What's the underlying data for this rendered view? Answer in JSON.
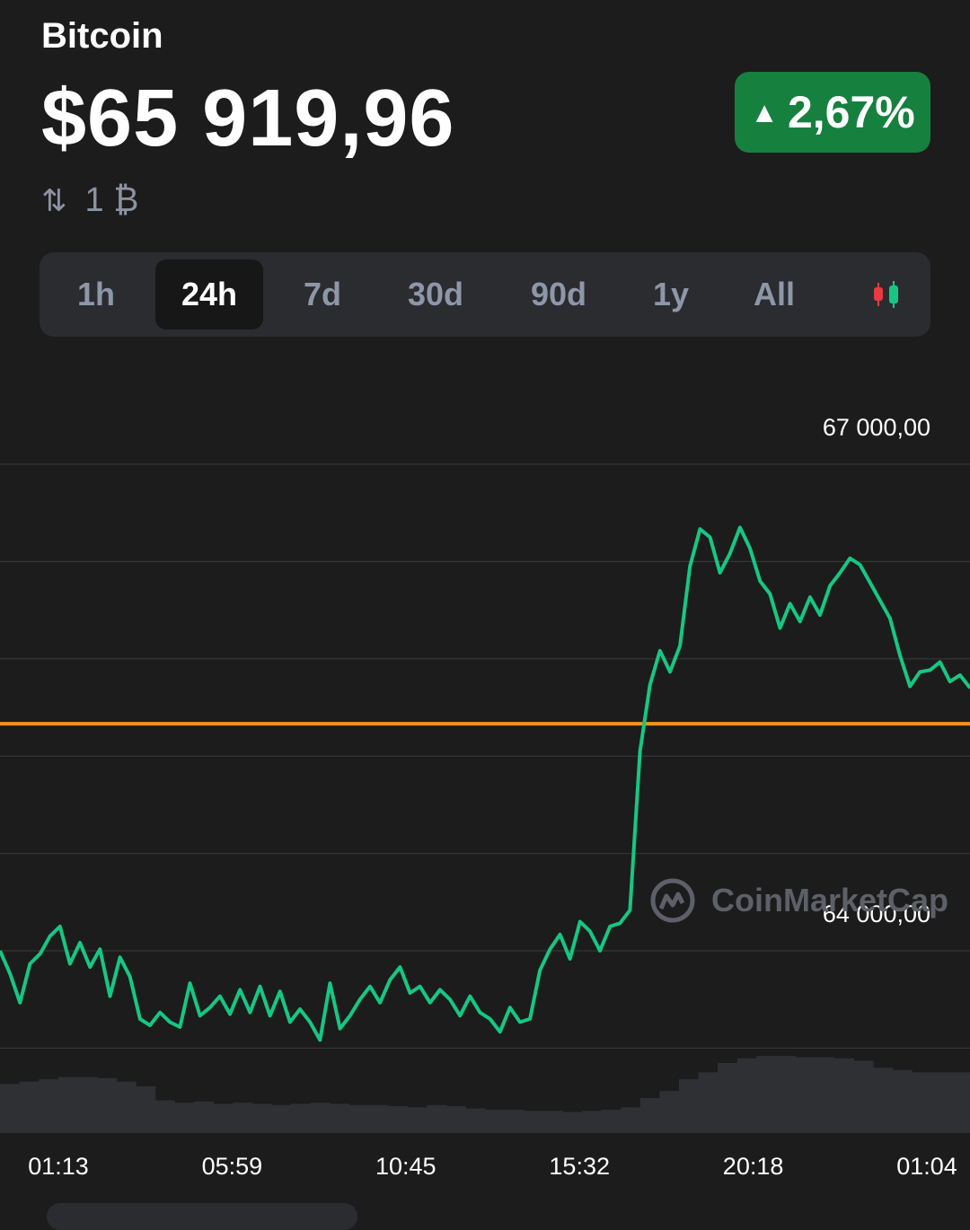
{
  "header": {
    "coin_name": "Bitcoin",
    "price": "$65 919,96",
    "conversion": "1 ₿",
    "swap_icon": "swap-arrows-icon",
    "change": "2,67%",
    "change_direction": "up",
    "change_color": "#16803f"
  },
  "tabs": [
    {
      "label": "1h"
    },
    {
      "label": "24h",
      "active": true
    },
    {
      "label": "7d"
    },
    {
      "label": "30d"
    },
    {
      "label": "90d"
    },
    {
      "label": "1y"
    },
    {
      "label": "All"
    }
  ],
  "candle_toggle_icon": "candlestick-icon",
  "watermark": "CoinMarketCap",
  "chart_data": {
    "type": "line",
    "price_labels": [
      "67 000,00",
      "64 000,00"
    ],
    "y_ticks": [
      64000,
      67000
    ],
    "ylim": [
      63500,
      67500
    ],
    "x_ticks": [
      "01:13",
      "05:59",
      "10:45",
      "15:32",
      "20:18",
      "01:04"
    ],
    "reference_line": {
      "value": 65400,
      "color": "#f7931a"
    },
    "line_color": "#16c784",
    "grid": true,
    "series": [
      {
        "points": [
          [
            0,
            64000
          ],
          [
            1,
            63860
          ],
          [
            2,
            63680
          ],
          [
            3,
            63920
          ],
          [
            4,
            63980
          ],
          [
            5,
            64090
          ],
          [
            6,
            64150
          ],
          [
            7,
            63920
          ],
          [
            8,
            64050
          ],
          [
            9,
            63900
          ],
          [
            10,
            64010
          ],
          [
            11,
            63720
          ],
          [
            12,
            63960
          ],
          [
            13,
            63840
          ],
          [
            14,
            63580
          ],
          [
            15,
            63540
          ],
          [
            16,
            63620
          ],
          [
            17,
            63560
          ],
          [
            18,
            63530
          ],
          [
            19,
            63800
          ],
          [
            20,
            63600
          ],
          [
            21,
            63650
          ],
          [
            22,
            63720
          ],
          [
            23,
            63610
          ],
          [
            24,
            63760
          ],
          [
            25,
            63620
          ],
          [
            26,
            63780
          ],
          [
            27,
            63600
          ],
          [
            28,
            63750
          ],
          [
            29,
            63560
          ],
          [
            30,
            63640
          ],
          [
            31,
            63560
          ],
          [
            32,
            63450
          ],
          [
            33,
            63800
          ],
          [
            34,
            63520
          ],
          [
            35,
            63600
          ],
          [
            36,
            63700
          ],
          [
            37,
            63780
          ],
          [
            38,
            63680
          ],
          [
            39,
            63820
          ],
          [
            40,
            63900
          ],
          [
            41,
            63740
          ],
          [
            42,
            63780
          ],
          [
            43,
            63680
          ],
          [
            44,
            63760
          ],
          [
            45,
            63700
          ],
          [
            46,
            63600
          ],
          [
            47,
            63720
          ],
          [
            48,
            63620
          ],
          [
            49,
            63580
          ],
          [
            50,
            63500
          ],
          [
            51,
            63650
          ],
          [
            52,
            63560
          ],
          [
            53,
            63580
          ],
          [
            54,
            63880
          ],
          [
            55,
            64010
          ],
          [
            56,
            64100
          ],
          [
            57,
            63950
          ],
          [
            58,
            64180
          ],
          [
            59,
            64120
          ],
          [
            60,
            64000
          ],
          [
            61,
            64150
          ],
          [
            62,
            64170
          ],
          [
            63,
            64250
          ],
          [
            64,
            65230
          ],
          [
            65,
            65640
          ],
          [
            66,
            65850
          ],
          [
            67,
            65720
          ],
          [
            68,
            65880
          ],
          [
            69,
            66370
          ],
          [
            70,
            66600
          ],
          [
            71,
            66550
          ],
          [
            72,
            66330
          ],
          [
            73,
            66450
          ],
          [
            74,
            66610
          ],
          [
            75,
            66480
          ],
          [
            76,
            66280
          ],
          [
            77,
            66200
          ],
          [
            78,
            65990
          ],
          [
            79,
            66140
          ],
          [
            80,
            66030
          ],
          [
            81,
            66180
          ],
          [
            82,
            66070
          ],
          [
            83,
            66250
          ],
          [
            84,
            66330
          ],
          [
            85,
            66420
          ],
          [
            86,
            66380
          ],
          [
            87,
            66270
          ],
          [
            88,
            66160
          ],
          [
            89,
            66050
          ],
          [
            90,
            65820
          ],
          [
            91,
            65630
          ],
          [
            92,
            65720
          ],
          [
            93,
            65730
          ],
          [
            94,
            65780
          ],
          [
            95,
            65660
          ],
          [
            96,
            65700
          ],
          [
            97,
            65620
          ]
        ]
      }
    ],
    "volume": {
      "color": "#2f3034",
      "values": [
        0.42,
        0.44,
        0.46,
        0.48,
        0.48,
        0.47,
        0.44,
        0.4,
        0.28,
        0.26,
        0.27,
        0.25,
        0.26,
        0.25,
        0.24,
        0.25,
        0.26,
        0.25,
        0.24,
        0.24,
        0.23,
        0.22,
        0.24,
        0.23,
        0.21,
        0.2,
        0.2,
        0.19,
        0.19,
        0.18,
        0.19,
        0.2,
        0.22,
        0.3,
        0.36,
        0.46,
        0.52,
        0.6,
        0.64,
        0.66,
        0.66,
        0.65,
        0.65,
        0.64,
        0.62,
        0.56,
        0.54,
        0.52,
        0.52,
        0.52
      ]
    }
  }
}
